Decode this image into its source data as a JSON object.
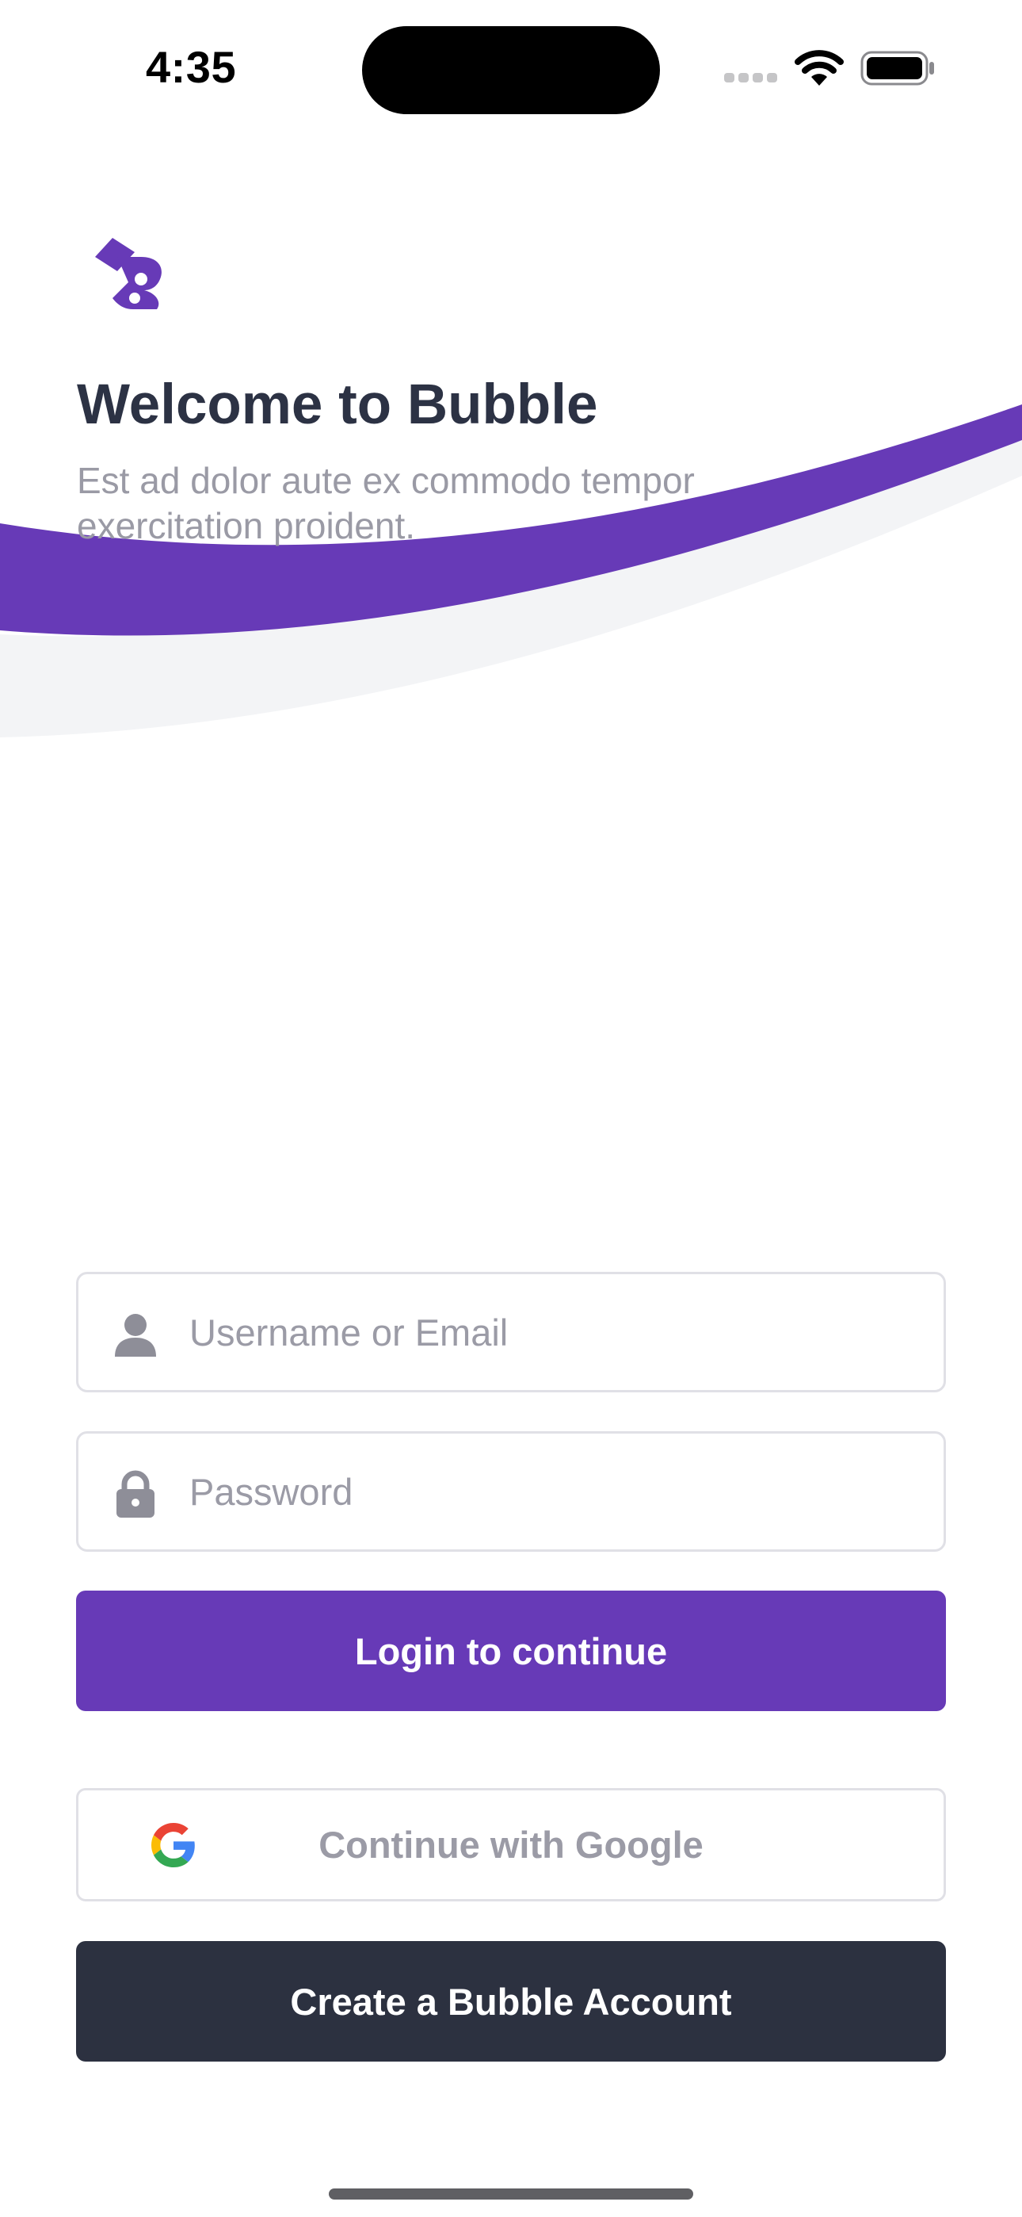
{
  "status_bar": {
    "time": "4:35"
  },
  "header": {
    "logo_icon": "bubble-logo-icon",
    "title": "Welcome to Bubble",
    "subtitle": "Est ad dolor aute ex commodo tempor exercitation proident."
  },
  "form": {
    "username": {
      "icon": "person-icon",
      "placeholder": "Username or Email",
      "value": ""
    },
    "password": {
      "icon": "lock-icon",
      "placeholder": "Password",
      "value": ""
    },
    "login_label": "Login to continue",
    "google": {
      "icon": "google-icon",
      "label": "Continue with Google"
    },
    "create_account_label": "Create a Bubble Account"
  },
  "colors": {
    "brand_purple": "#673ab7",
    "dark_navy": "#2c3140",
    "title_text": "#2c3244",
    "muted_text": "#9b9ba6",
    "field_border": "#e0e0e6",
    "wave_grey": "#f3f4f6"
  }
}
